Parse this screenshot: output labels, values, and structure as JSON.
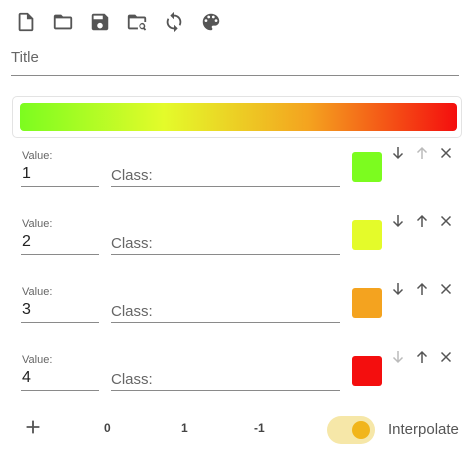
{
  "toolbar": {
    "icons": [
      "new-file-icon",
      "open-folder-icon",
      "save-icon",
      "browse-folder-icon",
      "refresh-icon",
      "palette-icon"
    ]
  },
  "title_field": {
    "label": "Title"
  },
  "rows": [
    {
      "value_label": "Value:",
      "value": "1",
      "class_label": "Class:",
      "color": "#7cfc1f"
    },
    {
      "value_label": "Value:",
      "value": "2",
      "class_label": "Class:",
      "color": "#e4fb2a"
    },
    {
      "value_label": "Value:",
      "value": "3",
      "class_label": "Class:",
      "color": "#f4a31f"
    },
    {
      "value_label": "Value:",
      "value": "4",
      "class_label": "Class:",
      "color": "#f40e0e"
    }
  ],
  "bottom": {
    "btn_0": "0",
    "btn_1": "1",
    "btn_neg1": "-1",
    "interpolate_label": "Interpolate",
    "interpolate_on": true
  },
  "colors": {
    "icon": "#555555",
    "disabled": "#bbbbbb",
    "toggle_track": "#f6e7a8",
    "toggle_knob": "#f1b51c"
  }
}
